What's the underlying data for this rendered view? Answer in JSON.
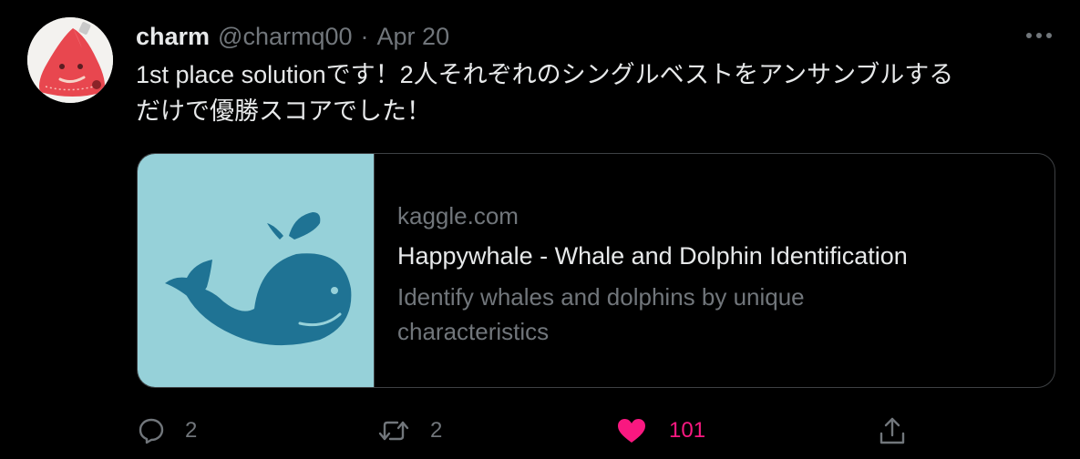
{
  "tweet": {
    "display_name": "charm",
    "handle": "@charmq00",
    "separator": "·",
    "date": "Apr 20",
    "more_icon": "more-dots-icon",
    "text_line1": "1st place solutionです！2人それぞれのシングルベストをアンサンブルする",
    "text_line2": "だけで優勝スコアでした！"
  },
  "card": {
    "domain": "kaggle.com",
    "title": "Happywhale - Whale and Dolphin Identification",
    "description": "Identify whales and dolphins by unique characteristics",
    "image_bg": "#96d1d9",
    "whale_color": "#1f7394"
  },
  "actions": {
    "reply_count": "2",
    "retweet_count": "2",
    "like_count": "101",
    "like_color": "#f91880"
  },
  "colors": {
    "background": "#000000",
    "text_primary": "#e7e9ea",
    "text_secondary": "#71767b",
    "border": "#3e4144",
    "avatar_red": "#e8474f"
  }
}
